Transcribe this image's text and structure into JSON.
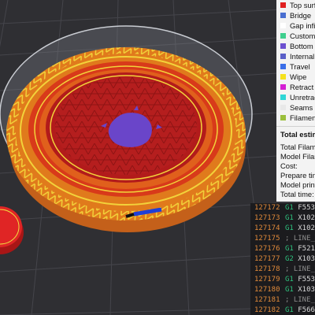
{
  "legend": {
    "items": [
      {
        "label": "Top surface",
        "color": "#e02020"
      },
      {
        "label": "Bridge",
        "color": "#4a6fd1"
      },
      {
        "label": "Gap infill",
        "color": "#ffffff"
      },
      {
        "label": "Custom",
        "color": "#3ecf8e"
      },
      {
        "label": "Bottom surface",
        "color": "#6b4fd0"
      },
      {
        "label": "Internal bridge",
        "color": "#5a5fc8"
      },
      {
        "label": "Travel",
        "color": "#3a6ee8"
      },
      {
        "label": "Wipe",
        "color": "#f5e11c"
      },
      {
        "label": "Retract",
        "color": "#d41fd4"
      },
      {
        "label": "Unretract",
        "color": "#2ed6d6"
      },
      {
        "label": "Seams",
        "color": "#e8e8e8"
      },
      {
        "label": "Filament",
        "color": "#9bbf3c"
      }
    ]
  },
  "stats": {
    "title": "Total estimation",
    "rows": [
      "Total Filament:",
      "Model Filament:",
      "Cost:",
      "Prepare time:",
      "Model printing time:",
      "Total time:"
    ]
  },
  "gcode": {
    "lines": [
      {
        "num": "127172",
        "op": "G1",
        "rest": " F5531.",
        "comment": false
      },
      {
        "num": "127173",
        "op": "G1",
        "rest": " X102.1",
        "comment": false
      },
      {
        "num": "127174",
        "op": "G1",
        "rest": " X102.6",
        "comment": false
      },
      {
        "num": "127175",
        "op": "",
        "rest": "; LINE_WIDTH",
        "comment": true
      },
      {
        "num": "127176",
        "op": "G1",
        "rest": " F5219.",
        "comment": false
      },
      {
        "num": "127177",
        "op": "G2",
        "rest": " X103.7",
        "comment": false
      },
      {
        "num": "127178",
        "op": "",
        "rest": "; LINE_WIDTH",
        "comment": true
      },
      {
        "num": "127179",
        "op": "G1",
        "rest": " F5534.",
        "comment": false
      },
      {
        "num": "127180",
        "op": "G1",
        "rest": " X103.7",
        "comment": false
      },
      {
        "num": "127181",
        "op": "",
        "rest": "; LINE_WIDTH",
        "comment": true
      },
      {
        "num": "127182",
        "op": "G1",
        "rest": " F5666.",
        "comment": false
      }
    ]
  }
}
